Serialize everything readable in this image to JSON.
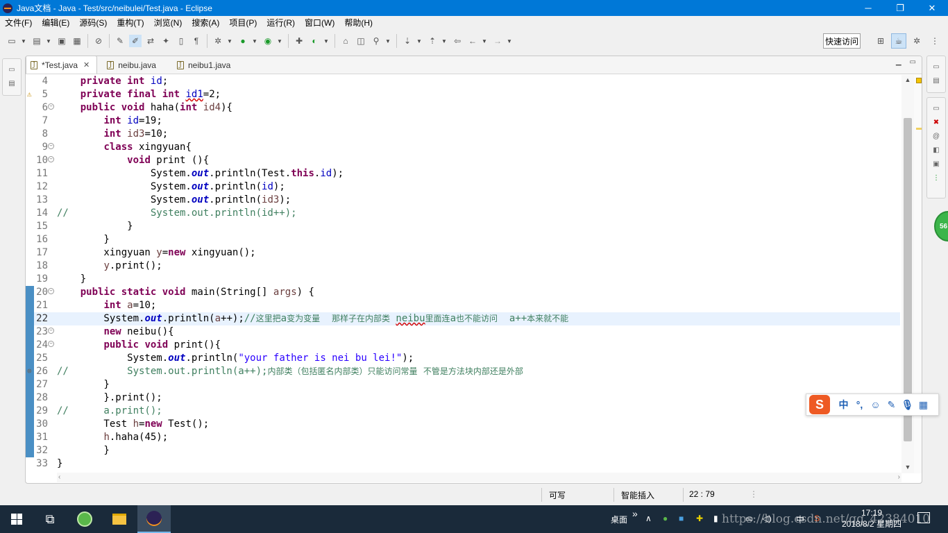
{
  "window": {
    "title": "Java文档 - Java - Test/src/neibulei/Test.java - Eclipse",
    "minimize": "─",
    "restore": "❐",
    "close": "✕"
  },
  "menu": [
    "文件(F)",
    "编辑(E)",
    "源码(S)",
    "重构(T)",
    "浏览(N)",
    "搜索(A)",
    "项目(P)",
    "运行(R)",
    "窗口(W)",
    "帮助(H)"
  ],
  "toolbar": {
    "quick_access": "快速访问"
  },
  "tabs": [
    {
      "label": "*Test.java",
      "active": true,
      "close": "✕"
    },
    {
      "label": "neibu.java",
      "active": false
    },
    {
      "label": "neibu1.java",
      "active": false
    }
  ],
  "editor": {
    "current_line": 22,
    "lines": [
      {
        "n": "4",
        "code": "    private int id;"
      },
      {
        "n": "5",
        "code": "    private final int id1=2;"
      },
      {
        "n": "6",
        "code": "    public void haha(int id4){"
      },
      {
        "n": "7",
        "code": "        int id=19;"
      },
      {
        "n": "8",
        "code": "        int id3=10;"
      },
      {
        "n": "9",
        "code": "        class xingyuan{"
      },
      {
        "n": "10",
        "code": "            void print (){"
      },
      {
        "n": "11",
        "code": "                System.out.println(Test.this.id);"
      },
      {
        "n": "12",
        "code": "                System.out.println(id);"
      },
      {
        "n": "13",
        "code": "                System.out.println(id3);"
      },
      {
        "n": "14",
        "code": "//              System.out.println(id++);"
      },
      {
        "n": "15",
        "code": "            }"
      },
      {
        "n": "16",
        "code": "        }"
      },
      {
        "n": "17",
        "code": "        xingyuan y=new xingyuan();"
      },
      {
        "n": "18",
        "code": "        y.print();"
      },
      {
        "n": "19",
        "code": "    }"
      },
      {
        "n": "20",
        "code": "    public static void main(String[] args) {"
      },
      {
        "n": "21",
        "code": "        int a=10;"
      },
      {
        "n": "22",
        "code": "        System.out.println(a++);//这里把a变为变量  那样子在内部类 neibu里面连a也不能访问  a++本来就不能"
      },
      {
        "n": "23",
        "code": "        new neibu(){"
      },
      {
        "n": "24",
        "code": "        public void print(){"
      },
      {
        "n": "25",
        "code": "            System.out.println(\"your father is nei bu lei!\");"
      },
      {
        "n": "26",
        "code": "//          System.out.println(a++);内部类（包括匿名内部类）只能访问常量 不管是方法块内部还是外部"
      },
      {
        "n": "27",
        "code": "        }"
      },
      {
        "n": "28",
        "code": "        }.print();"
      },
      {
        "n": "29",
        "code": "//      a.print();"
      },
      {
        "n": "30",
        "code": "        Test h=new Test();"
      },
      {
        "n": "31",
        "code": "        h.haha(45);"
      },
      {
        "n": "32",
        "code": "        }"
      },
      {
        "n": "33",
        "code": "}"
      }
    ]
  },
  "ime": {
    "logo": "S",
    "mode": "中",
    "punct": "°,"
  },
  "status": {
    "writable": "可写",
    "insert_mode": "智能插入",
    "position": "22 : 79"
  },
  "taskbar": {
    "desktop": "桌面",
    "chevron": "»",
    "ime_lang": "中",
    "time": "17:19",
    "date": "2018/8/2 星期四",
    "watermark": "https://blog.csdn.net/qq_42384010"
  },
  "badge": "56"
}
